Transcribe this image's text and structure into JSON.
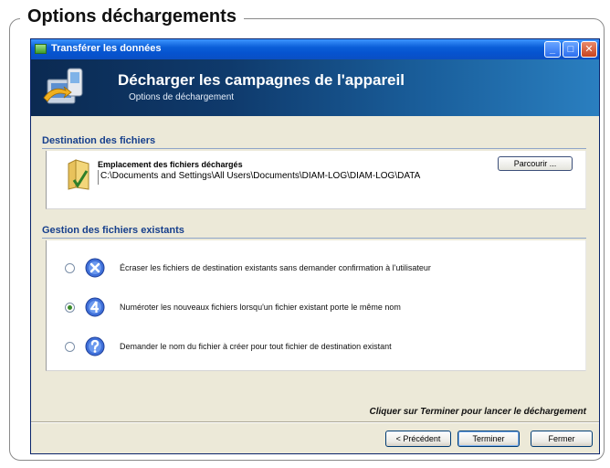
{
  "heading": "Options déchargements",
  "window": {
    "title": "Transférer les données",
    "controls": {
      "minimize": "_",
      "maximize": "□",
      "close": "✕"
    }
  },
  "banner": {
    "title": "Décharger les campagnes de l'appareil",
    "subtitle": "Options de déchargement"
  },
  "destination": {
    "section_title": "Destination des fichiers",
    "label": "Emplacement des fichiers déchargés",
    "path": "C:\\Documents and Settings\\All Users\\Documents\\DIAM-LOG\\DIAM-LOG\\DATA",
    "browse_label": "Parcourir ..."
  },
  "existing": {
    "section_title": "Gestion des fichiers existants",
    "options": [
      {
        "label": "Écraser les fichiers de destination existants sans demander confirmation à l'utilisateur",
        "icon": "x-circle-icon",
        "selected": false
      },
      {
        "label": "Numéroter les nouveaux fichiers lorsqu'un fichier existant porte le même nom",
        "icon": "number-4-icon",
        "selected": true
      },
      {
        "label": "Demander le nom du fichier à créer pour tout fichier de destination existant",
        "icon": "question-icon",
        "selected": false
      }
    ]
  },
  "hint": "Cliquer sur Terminer pour lancer le déchargement",
  "buttons": {
    "previous": "< Précédent",
    "finish": "Terminer",
    "close": "Fermer"
  },
  "colors": {
    "titlebar": "#0a5ed8",
    "section_title": "#163f8c",
    "banner": "#0f3a6c"
  }
}
